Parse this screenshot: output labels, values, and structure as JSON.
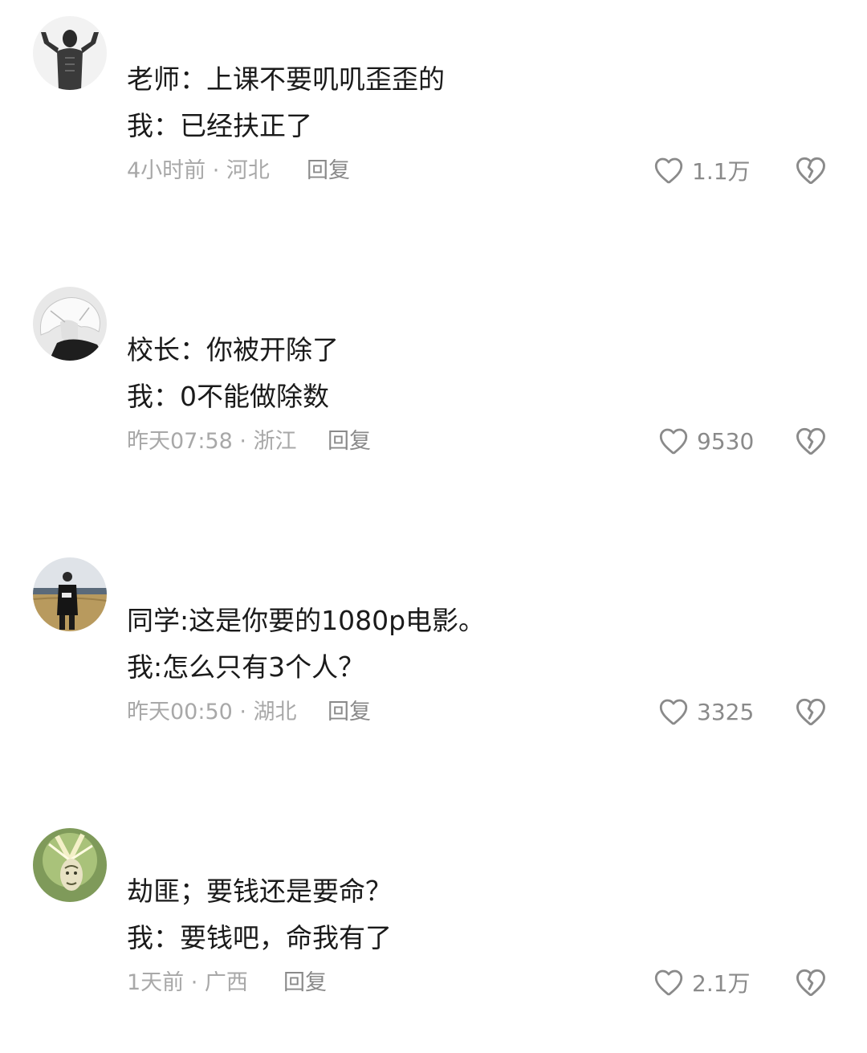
{
  "comments": [
    {
      "avatar_icon": "muscular-man-avatar",
      "line1": "老师：上课不要叽叽歪歪的",
      "line2": "我：已经扶正了",
      "meta": "4小时前 · 河北",
      "reply_label": "回复",
      "like_count": "1.1万"
    },
    {
      "avatar_icon": "white-hair-anime-avatar",
      "line1": "校长：你被开除了",
      "line2": "我：0不能做除数",
      "meta": "昨天07:58 · 浙江",
      "reply_label": "回复",
      "like_count": "9530"
    },
    {
      "avatar_icon": "man-in-field-avatar",
      "line1": "同学:这是你要的1080p电影。",
      "line2": "我:怎么只有3个人？",
      "meta": "昨天00:50 · 湖北",
      "reply_label": "回复",
      "like_count": "3325"
    },
    {
      "avatar_icon": "green-cartoon-avatar",
      "line1": "劫匪；要钱还是要命？",
      "line2": "我：要钱吧，命我有了",
      "meta": "1天前 · 广西",
      "reply_label": "回复",
      "like_count": "2.1万"
    }
  ],
  "icons": {
    "like": "heart-outline-icon",
    "dislike": "broken-heart-icon"
  },
  "colors": {
    "text_primary": "#1a1a1a",
    "text_meta": "#a8a8a8",
    "icon_gray": "#8a8a8a"
  }
}
